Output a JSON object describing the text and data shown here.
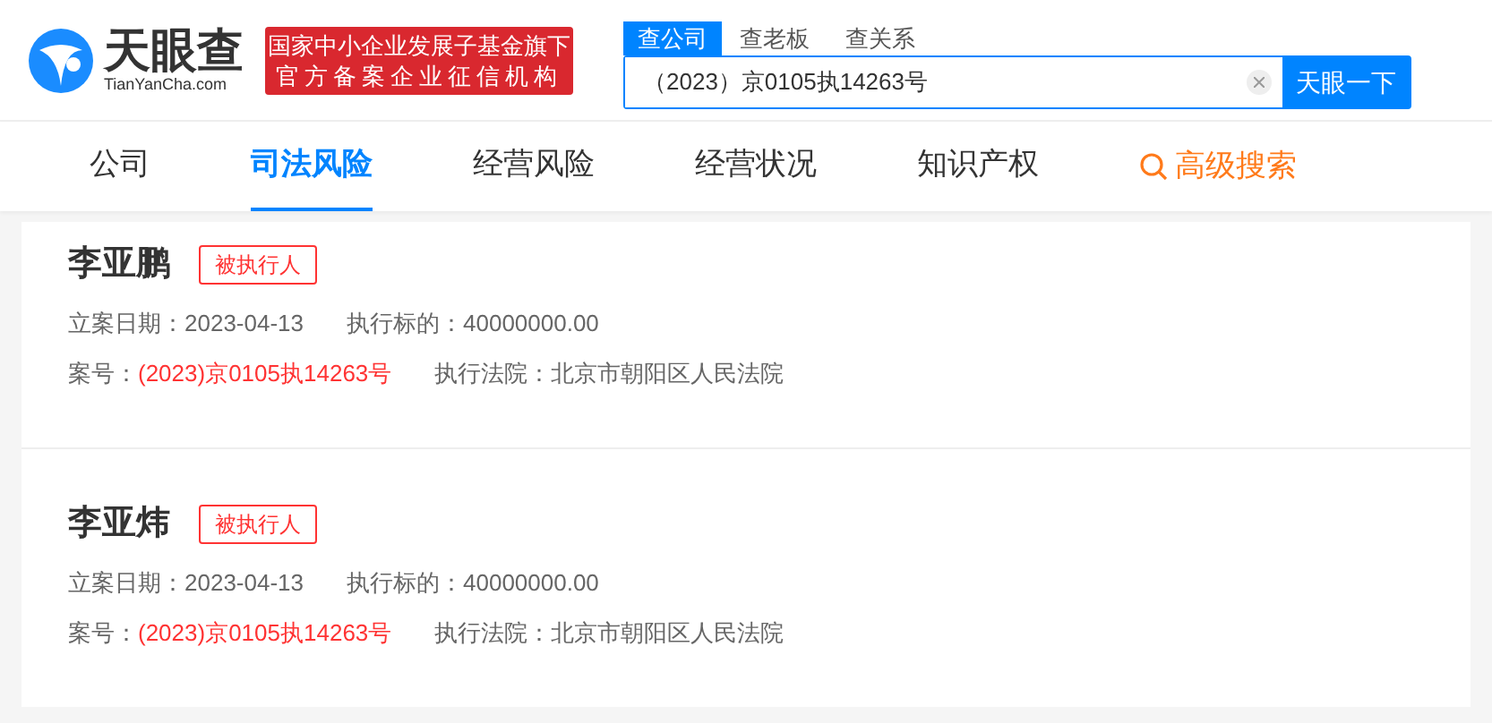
{
  "logo": {
    "name": "天眼查",
    "domain": "TianYanCha.com"
  },
  "banner": {
    "line1": "国家中小企业发展子基金旗下",
    "line2": "官方备案企业征信机构"
  },
  "search_tabs": [
    {
      "label": "查公司",
      "selected": true
    },
    {
      "label": "查老板",
      "selected": false
    },
    {
      "label": "查关系",
      "selected": false
    }
  ],
  "search": {
    "value": "（2023）京0105执14263号",
    "button": "天眼一下"
  },
  "nav": [
    {
      "label": "公司",
      "selected": false,
      "kind": "tab"
    },
    {
      "label": "司法风险",
      "selected": true,
      "kind": "tab"
    },
    {
      "label": "经营风险",
      "selected": false,
      "kind": "tab"
    },
    {
      "label": "经营状况",
      "selected": false,
      "kind": "tab"
    },
    {
      "label": "知识产权",
      "selected": false,
      "kind": "tab"
    },
    {
      "label": "高级搜索",
      "selected": false,
      "kind": "search"
    }
  ],
  "records": [
    {
      "name": "李亚鹏",
      "tag": "被执行人",
      "fields": [
        [
          {
            "label": "立案日期：",
            "value": "2023-04-13",
            "highlight": false
          },
          {
            "label": "执行标的：",
            "value": "40000000.00",
            "highlight": false
          }
        ],
        [
          {
            "label": "案号：",
            "value": "(2023)京0105执14263号",
            "highlight": true
          },
          {
            "label": "执行法院：",
            "value": "北京市朝阳区人民法院",
            "highlight": false
          }
        ]
      ]
    },
    {
      "name": "李亚炜",
      "tag": "被执行人",
      "fields": [
        [
          {
            "label": "立案日期：",
            "value": "2023-04-13",
            "highlight": false
          },
          {
            "label": "执行标的：",
            "value": "40000000.00",
            "highlight": false
          }
        ],
        [
          {
            "label": "案号：",
            "value": "(2023)京0105执14263号",
            "highlight": true
          },
          {
            "label": "执行法院：",
            "value": "北京市朝阳区人民法院",
            "highlight": false
          }
        ]
      ]
    }
  ]
}
